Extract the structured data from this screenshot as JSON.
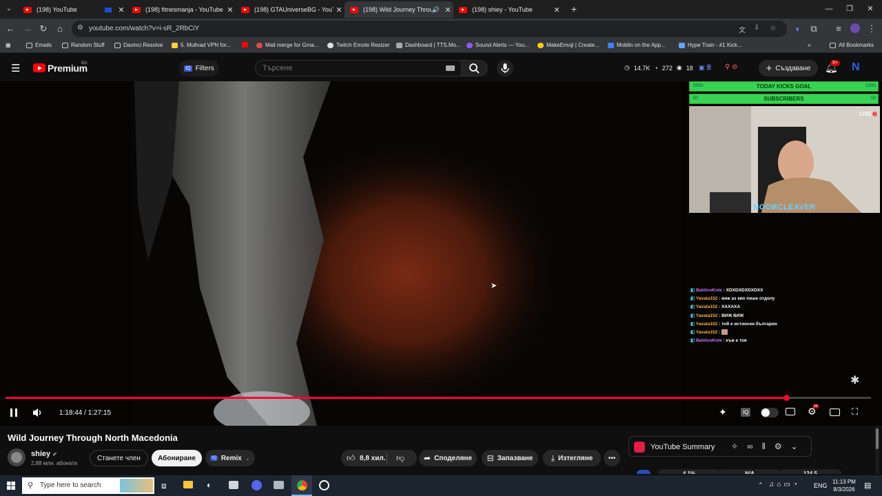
{
  "browser": {
    "tabs": [
      {
        "title": "(198) YouTube"
      },
      {
        "title": "(198) fitnesmanja - YouTube"
      },
      {
        "title": "(198) GTAUniverseBG - YouTube"
      },
      {
        "title": "(198) Wild Journey Throug"
      },
      {
        "title": "(198) shiey - YouTube"
      }
    ],
    "url": "youtube.com/watch?v=i-sR_2RbCiY",
    "bookmarks": [
      "Emails",
      "Random Stuff",
      "Davinci Resolve",
      "5. Mullvad VPN for...",
      "Mail merge for Gma...",
      "Twitch Emote Resizer",
      "Dashboard | TTS.Mo...",
      "Sound Alerts — You...",
      "MakeEmoji | Create...",
      "Moblin on the App...",
      "Hype Train - #1 Kick..."
    ],
    "all_bookmarks": "All Bookmarks"
  },
  "youtube": {
    "logo_text": "Premium",
    "region": "BG",
    "filters_label": "Filters",
    "search_placeholder": "Търсене",
    "stats": {
      "views": "14.7K",
      "likes": "272",
      "watching": "18"
    },
    "create_label": "Създаване",
    "notif_badge": "9+",
    "avatar_letter": "N"
  },
  "overlay": {
    "goal_left": "1950",
    "goal_label": "TODAY KICKS GOAL",
    "goal_right": "1000",
    "goal_progress": 1.0,
    "subs_left": "10",
    "subs_label": "SUBSCRIBERS",
    "subs_right": "10",
    "subs_progress": 1.0,
    "live_label": "LIVE",
    "streamer_name": "NOOBCLEAVER",
    "chat": [
      {
        "user": "BahlivoKote",
        "text": "XDXDXDXDXDXX",
        "color": "#c07cff"
      },
      {
        "user": "Yavata152",
        "text": "виж аз кво пише отдолу",
        "color": "#ffb347"
      },
      {
        "user": "Yavata152",
        "text": "ХАХАХА",
        "color": "#ffb347"
      },
      {
        "user": "Yavata152",
        "text": "ВИЖ ВИЖ",
        "color": "#ffb347"
      },
      {
        "user": "Yavata152",
        "text": "той е истински българин",
        "color": "#ffb347"
      },
      {
        "user": "Yavata152",
        "text": "",
        "color": "#ffb347"
      },
      {
        "user": "BahlivoKote",
        "text": "къв е тоя",
        "color": "#c07cff"
      }
    ]
  },
  "player": {
    "time_current": "1:18:44",
    "time_total": "1:27:15",
    "progress": 0.902
  },
  "video_info": {
    "title": "Wild Journey Through North Macedonia",
    "channel": "shiey",
    "subscribers": "2,88 млн. абонати",
    "join_label": "Станете член",
    "subscribe_label": "Абониране",
    "remix_label": "Remix",
    "likes": "8,8 хил.",
    "share_label": "Споделяне",
    "save_label": "Запазване",
    "download_label": "Изтегляне"
  },
  "summary": {
    "title": "YouTube Summary",
    "stats": [
      "4.1%",
      "N/A",
      "124.5"
    ]
  },
  "taskbar": {
    "search_placeholder": "Type here to search",
    "lang": "ENG",
    "time": "11:13 PM",
    "date": "8/3/2026"
  },
  "colors": {
    "yt_red": "#ff0000",
    "progress_red": "#ff0033",
    "goal_green": "#39d353"
  }
}
